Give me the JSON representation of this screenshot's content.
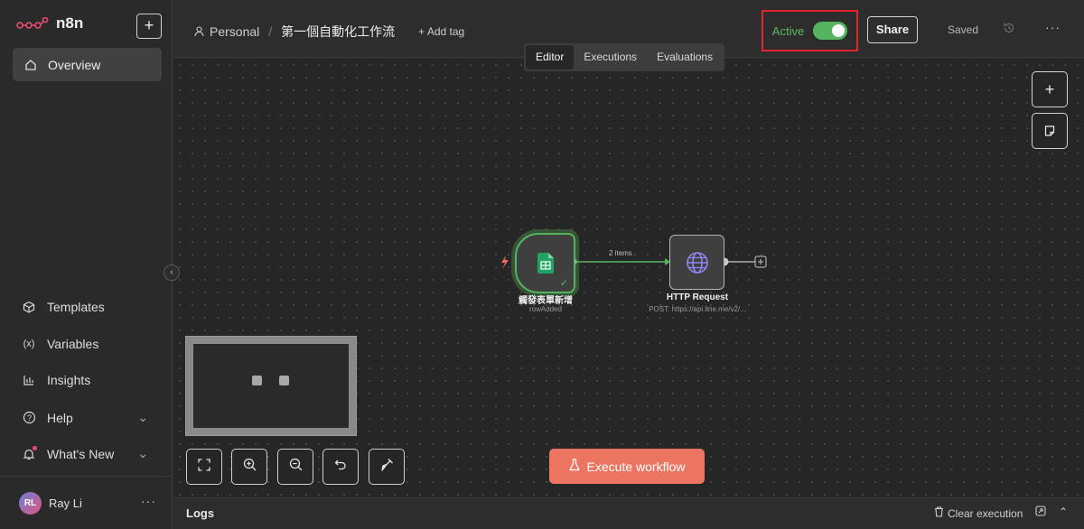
{
  "app": {
    "name": "n8n"
  },
  "sidebar": {
    "new_label": "+",
    "overview": "Overview",
    "items": [
      {
        "label": "Templates",
        "icon": "cube-icon"
      },
      {
        "label": "Variables",
        "icon": "variable-icon"
      },
      {
        "label": "Insights",
        "icon": "chart-icon"
      },
      {
        "label": "Help",
        "icon": "help-icon"
      },
      {
        "label": "What's New",
        "icon": "bell-icon"
      }
    ],
    "user": {
      "initials": "RL",
      "name": "Ray Li",
      "more": "···"
    }
  },
  "header": {
    "project": "Personal",
    "separator": "/",
    "workflow_name": "第一個自動化工作流",
    "add_tag": "+ Add tag",
    "active_label": "Active",
    "active": true,
    "share": "Share",
    "save_status": "Saved",
    "more": "···"
  },
  "tabs": [
    {
      "label": "Editor",
      "selected": true
    },
    {
      "label": "Executions",
      "selected": false
    },
    {
      "label": "Evaluations",
      "selected": false
    }
  ],
  "canvas": {
    "nodes": [
      {
        "name": "觸發表單新增",
        "subtitle": "rowAdded",
        "icon": "google-sheets-icon"
      },
      {
        "name": "HTTP Request",
        "subtitle": "POST: https://api.line.me/v2/...",
        "icon": "globe-icon"
      }
    ],
    "connection_label": "2 items",
    "execute_label": "Execute workflow"
  },
  "logs": {
    "label": "Logs",
    "clear_label": "Clear execution"
  },
  "colors": {
    "accent": "#ec7561",
    "active_green": "#55b55e",
    "highlight_border": "#e3242b",
    "sheets_green": "#1fa463"
  }
}
